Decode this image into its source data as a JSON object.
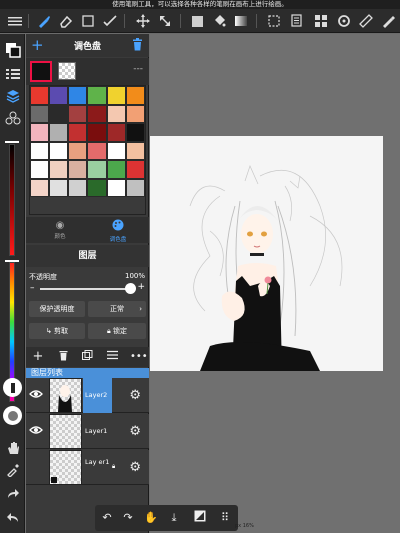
{
  "hint": "使用笔刷工具，可以选择各种各样的笔刷在画布上进行绘画。",
  "toolbar": {
    "icons": [
      "menu-icon",
      "brush-icon",
      "eraser-icon",
      "rect-select-icon",
      "fill-tool-icon",
      "move-icon",
      "transform-icon",
      "color-fill-icon",
      "bucket-icon",
      "gradient-icon",
      "selection-icon",
      "layer-panel-icon",
      "material-icon",
      "rotate-icon",
      "ruler-icon",
      "pen-icon"
    ]
  },
  "colors": {
    "accent": "#4aa3ff",
    "selected_layer": "#4a90d9"
  },
  "color_panel": {
    "title": "调色盘",
    "more": "---",
    "palette": [
      "#e8392e",
      "#5b4bb0",
      "#2f86e6",
      "#5fb34a",
      "#f0d22e",
      "#f28c1a",
      "#6b6b6b",
      "#2a2a2a",
      "#a34040",
      "#8c1a1a",
      "#f4c8b0",
      "#f2a074",
      "#f3b5be",
      "#b0b0b0",
      "#c23030",
      "#7a0d0d",
      "#9e2828",
      "#111111",
      "#ffffff",
      "#ffffff",
      "#e8a080",
      "#e36b6b",
      "#ffffff",
      "#f4c0a0",
      "#ffffff",
      "#f0d0c0",
      "#d9b0a0",
      "#9acfa0",
      "#4ca84c",
      "#dd3333",
      "#f4d4c8",
      "#e0e0e0",
      "#d0d0d0",
      "#2a6a2a",
      "#ffffff",
      "#c0c0c0"
    ],
    "tabs": [
      {
        "label": "颜色",
        "icon": "palette-small-icon"
      },
      {
        "label": "调色盘",
        "icon": "palette-icon"
      }
    ]
  },
  "layers": {
    "title": "图层",
    "opacity_label": "不透明度",
    "opacity_value": "100%",
    "opacity_fraction": 1.0,
    "protect_alpha": "保护透明度",
    "blend_mode": "正常",
    "clip": "剪取",
    "lock": "锁定",
    "list_label": "图层列表",
    "items": [
      {
        "name": "Layer2",
        "selected": true,
        "visible": true
      },
      {
        "name": "Layer1",
        "selected": false,
        "visible": true
      },
      {
        "name": "Lay er1",
        "selected": false,
        "visible": false
      }
    ]
  },
  "status": {
    "zoom": "px 16%"
  }
}
